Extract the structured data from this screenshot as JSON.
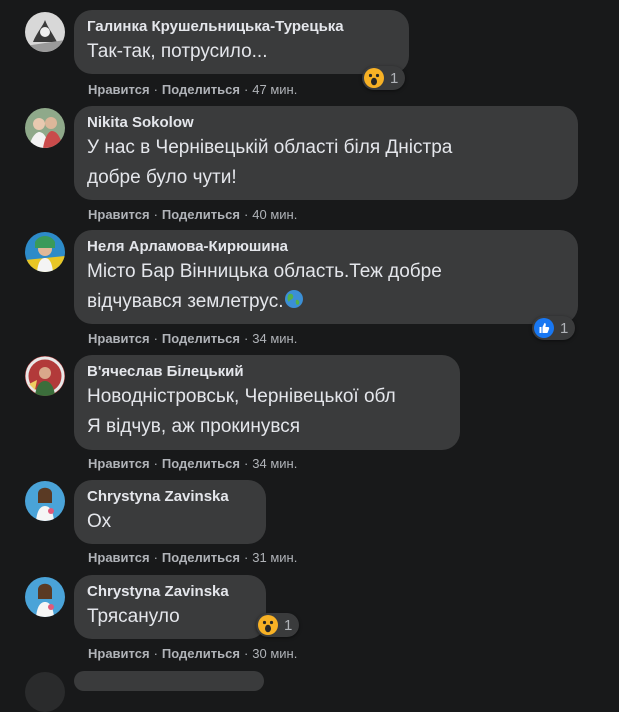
{
  "comments": [
    {
      "author": "Галинка Крушельницька-Турецька",
      "lines": [
        "Так-так, потрусило..."
      ],
      "like": "Нравится",
      "share": "Поделиться",
      "time": "47 мин.",
      "reaction": {
        "type": "wow",
        "count": "1"
      }
    },
    {
      "author": "Nikita Sokolow",
      "lines": [
        "У нас в Чернівецькій області біля Дністра",
        "добре було чути!"
      ],
      "like": "Нравится",
      "share": "Поделиться",
      "time": "40 мин."
    },
    {
      "author": "Неля Арламова-Кирюшина",
      "lines": [
        "Місто Бар Вінницька область.Теж добре",
        "відчувався землетрус."
      ],
      "emoji": "globe-emoji",
      "like": "Нравится",
      "share": "Поделиться",
      "time": "34 мин.",
      "reaction": {
        "type": "like",
        "count": "1"
      }
    },
    {
      "author": "В'ячеслав Білецький",
      "lines": [
        "Новодністровськ, Чернівецької обл",
        "Я відчув, аж прокинувся"
      ],
      "like": "Нравится",
      "share": "Поделиться",
      "time": "34 мин."
    },
    {
      "author": "Chrystyna Zavinska",
      "lines": [
        "Ох"
      ],
      "like": "Нравится",
      "share": "Поделиться",
      "time": "31 мин."
    },
    {
      "author": "Chrystyna Zavinska",
      "lines": [
        "Трясануло"
      ],
      "like": "Нравится",
      "share": "Поделиться",
      "time": "30 мин.",
      "reaction": {
        "type": "wow",
        "count": "1"
      }
    }
  ],
  "separator": "·",
  "colors": {
    "background": "#18191a",
    "bubble": "#3a3b3c",
    "text": "#e4e6eb",
    "secondary": "#b0b3b8",
    "like_blue": "#1877f2",
    "wow_yellow": "#f7b125"
  }
}
